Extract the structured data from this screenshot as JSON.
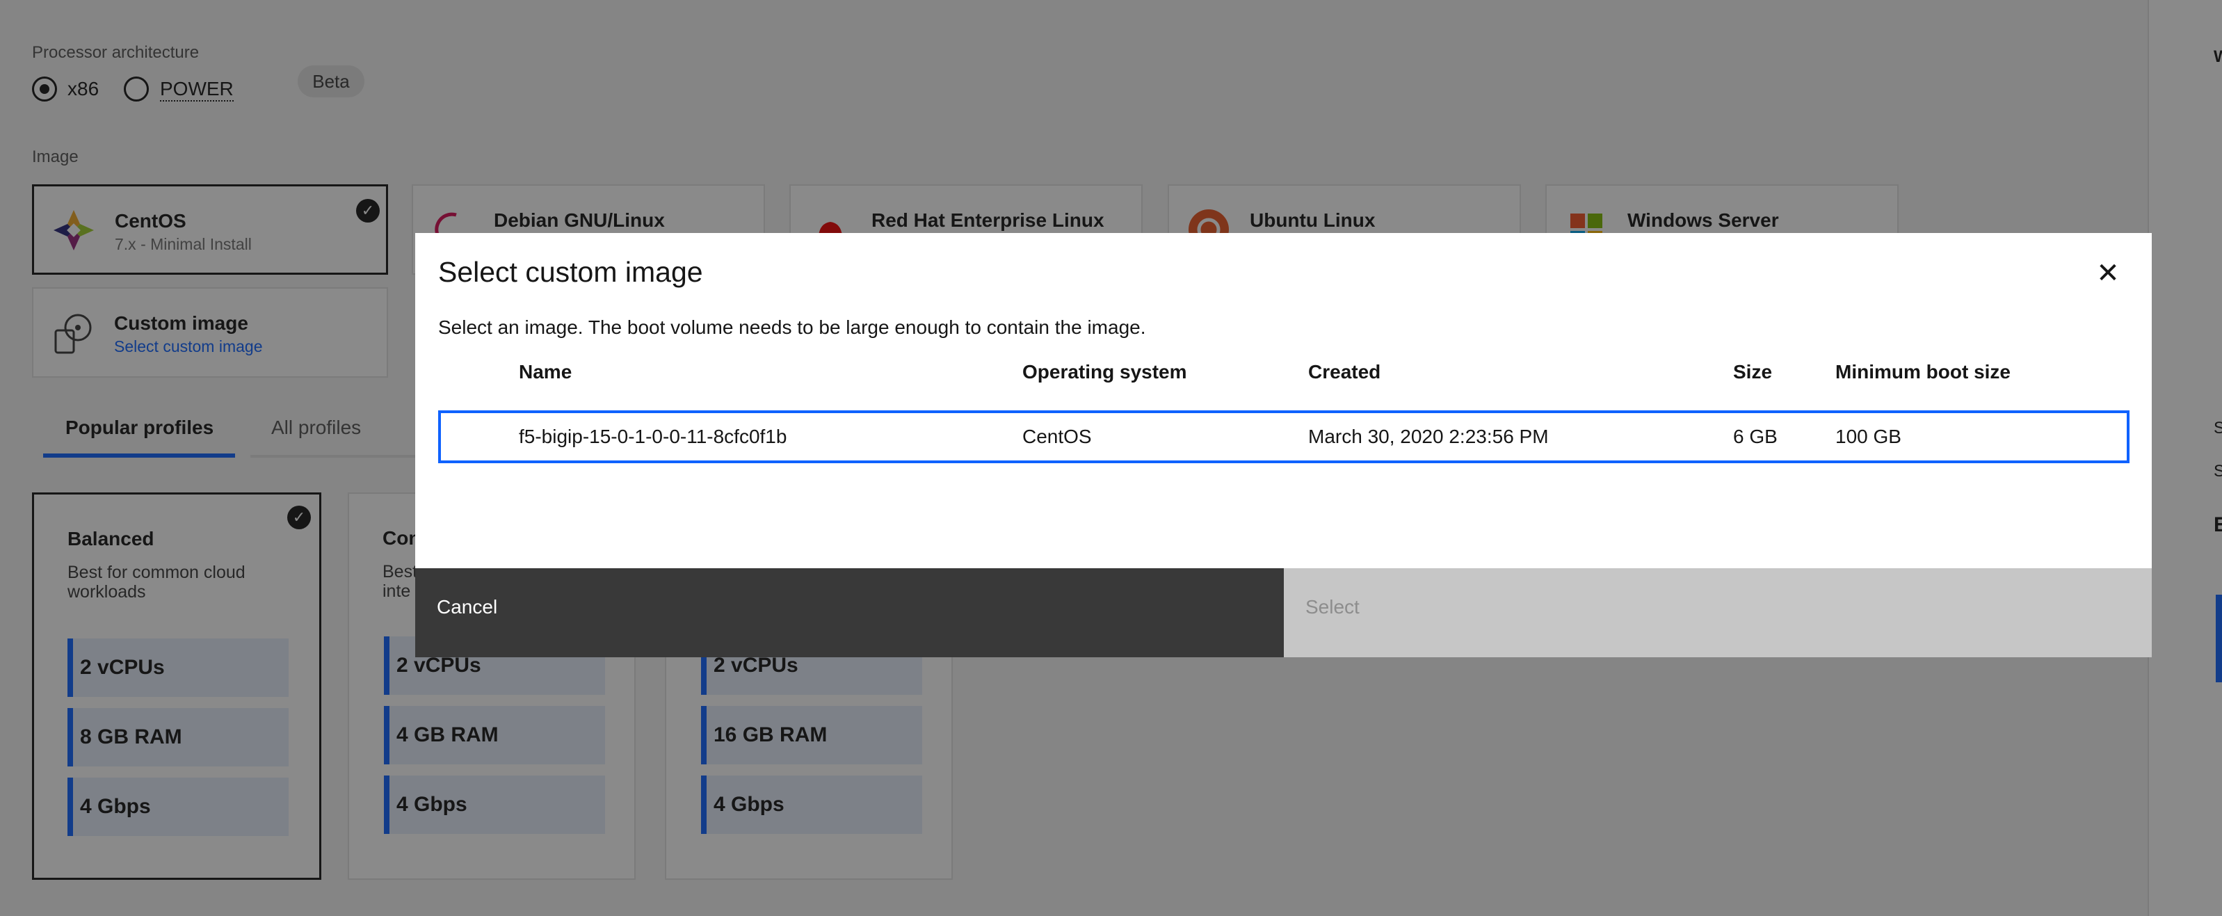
{
  "processor": {
    "label": "Processor architecture",
    "options": [
      {
        "label": "x86",
        "checked": true
      },
      {
        "label": "POWER",
        "checked": false
      }
    ],
    "badge": "Beta"
  },
  "image": {
    "label": "Image",
    "tiles": [
      {
        "title": "CentOS",
        "subtitle": "7.x - Minimal Install",
        "selected": true
      },
      {
        "title": "Debian GNU/Linux"
      },
      {
        "title": "Red Hat Enterprise Linux"
      },
      {
        "title": "Ubuntu Linux"
      },
      {
        "title": "Windows Server"
      }
    ],
    "custom": {
      "title": "Custom image",
      "link": "Select custom image"
    }
  },
  "tabs": [
    {
      "label": "Popular profiles",
      "active": true
    },
    {
      "label": "All profiles",
      "active": false
    }
  ],
  "profiles": [
    {
      "title": "Balanced",
      "description": "Best for common cloud workloads",
      "specs": [
        "2 vCPUs",
        "8 GB RAM",
        "4 Gbps"
      ],
      "selected": true
    },
    {
      "title": "Con",
      "description": "Best inte",
      "specs": [
        "2 vCPUs",
        "4 GB RAM",
        "4 Gbps"
      ]
    },
    {
      "title": "",
      "description": "",
      "specs": [
        "2 vCPUs",
        "16 GB RAM",
        "4 Gbps"
      ]
    }
  ],
  "right_panel": {
    "letters": [
      "W",
      "S",
      "S",
      "E"
    ]
  },
  "modal": {
    "title": "Select custom image",
    "close_glyph": "✕",
    "description": "Select an image. The boot volume needs to be large enough to contain the image.",
    "columns": [
      "Name",
      "Operating system",
      "Created",
      "Size",
      "Minimum boot size"
    ],
    "rows": [
      {
        "name": "f5-bigip-15-0-1-0-0-11-8cfc0f1b",
        "os": "CentOS",
        "created": "March 30, 2020 2:23:56 PM",
        "size": "6 GB",
        "min_boot": "100 GB",
        "selected": true
      }
    ],
    "cancel_label": "Cancel",
    "select_label": "Select"
  },
  "colors": {
    "accent": "#0f62fe",
    "overlay": "rgba(22,22,22,0.5)",
    "cancel_bg": "#393939",
    "select_disabled_bg": "#c6c6c6"
  }
}
